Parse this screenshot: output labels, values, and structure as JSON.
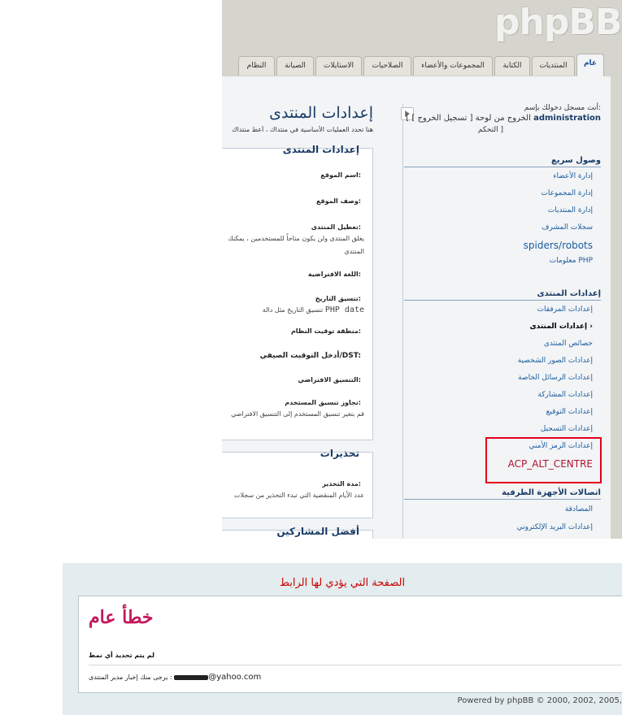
{
  "logo": "phpBB",
  "tabs": [
    {
      "label": "عام",
      "active": true
    },
    {
      "label": "المنتديات"
    },
    {
      "label": "الكتابة"
    },
    {
      "label": "المجموعات والأعضاء"
    },
    {
      "label": "الصلاحيات"
    },
    {
      "label": "الاستايلات"
    },
    {
      "label": "الصيانة"
    },
    {
      "label": "النظام"
    }
  ],
  "user": {
    "logged_as": "أنت مسجل دخولك بإسم:",
    "name": "administration",
    "logout": "[ تسجيل الخروج ]",
    "exit_acp": "[ الخروج من لوحة",
    "exit_acp2": "التحكم ]"
  },
  "quick_access": {
    "heading": "وصول سريع",
    "items": [
      "إدارة الأعضاء",
      "إدارة المجموعات",
      "إدارة المنتديات",
      "سجلات المشرف",
      "spiders/robots",
      "معلومات PHP"
    ]
  },
  "board_settings": {
    "heading": "إعدادات المنتدى",
    "items": [
      "إعدادات المرفقات",
      "إعدادات المنتدى",
      "خصائص المنتدى",
      "إعدادات الصور الشخصية",
      "إعدادات الرسائل الخاصة",
      "إعدادات المشاركة",
      "إعدادات التوقيع",
      "إعدادات التسجيل",
      "إعدادات الرمز الأمني",
      "ACP_ALT_CENTRE"
    ]
  },
  "client_comm": {
    "heading": "اتصالات الأجهزة الطرفية",
    "items": [
      "المصادقة",
      "إعدادات البريد الإلكتروني"
    ]
  },
  "content": {
    "title": "إعدادات المنتدى",
    "desc": "هنا تحدد العمليات الأساسية في منتداك ، أعط منتداك",
    "box1_title": "إعدادات المنتدى",
    "fields": [
      {
        "label": "اسم الموقع:"
      },
      {
        "label": "وصف الموقع:"
      },
      {
        "label": "تعطيل المنتدى:",
        "desc": "يغلق المنتدى ولن يكون متاحاً للمستخدمين ، يمكنك",
        "desc2": "المنتدى"
      },
      {
        "label": "اللغة الافتراضية:"
      },
      {
        "label": "تنسيق التاريخ:",
        "desc": "تنسيق التاريخ مثل دالة",
        "code": "PHP date"
      },
      {
        "label": "منطقة توقيت النظام:"
      },
      {
        "label": "أدخل التوقيت الصيفي/DST:"
      },
      {
        "label": "التنسيق الافتراضي:"
      },
      {
        "label": "تجاوز تنسيق المستخدم:",
        "desc": "قم بتغير تنسيق المستخدم إلى التنسيق الافتراضي"
      }
    ],
    "box2_title": "تحذيرات",
    "warn_label": "مدة التحذير:",
    "warn_desc": "عدد الأيام المنقضية التي تبدء التحذير من سجلات",
    "box3_title": "أفضل المشاركين"
  },
  "error_page": {
    "caption": "الصفحة التي يؤدي لها الرابط",
    "title": "خطأ عام",
    "message": "لم يتم تحديد أي نمط",
    "contact_prefix": "يرجى منك إخبار مدير المنتدى :",
    "email_domain": "@yahoo.com",
    "powered": "Powered by phpBB © 2000, 2002, 2005,"
  },
  "colors": {
    "highlight": "#e3001b",
    "error_title": "#c2185b",
    "link": "#1b5c9e"
  }
}
